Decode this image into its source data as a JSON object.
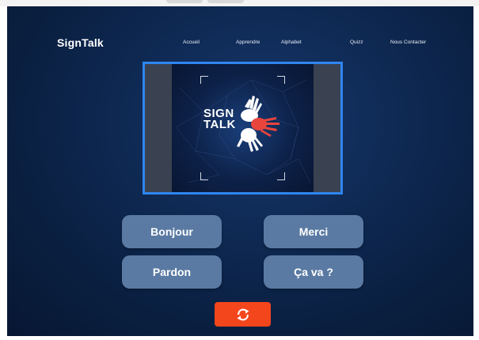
{
  "app": {
    "brand": "SignTalk"
  },
  "nav": {
    "items": [
      {
        "label": "Accueil"
      },
      {
        "label": "Apprendre"
      },
      {
        "label": "Alphabet"
      },
      {
        "label": "Quizz"
      },
      {
        "label": "Nous Contacter"
      }
    ]
  },
  "video": {
    "logo_line1": "SIGN",
    "logo_line2": "TALK"
  },
  "phrases": [
    {
      "label": "Bonjour"
    },
    {
      "label": "Merci"
    },
    {
      "label": "Pardon"
    },
    {
      "label": "Ça va ?"
    }
  ],
  "controls": {
    "refresh_icon": "refresh-icon"
  },
  "colors": {
    "background": "#0f2a55",
    "accent_border": "#2f86f0",
    "button": "#5a7aa3",
    "refresh": "#f4461c",
    "logo_hand_red": "#e8453c"
  }
}
